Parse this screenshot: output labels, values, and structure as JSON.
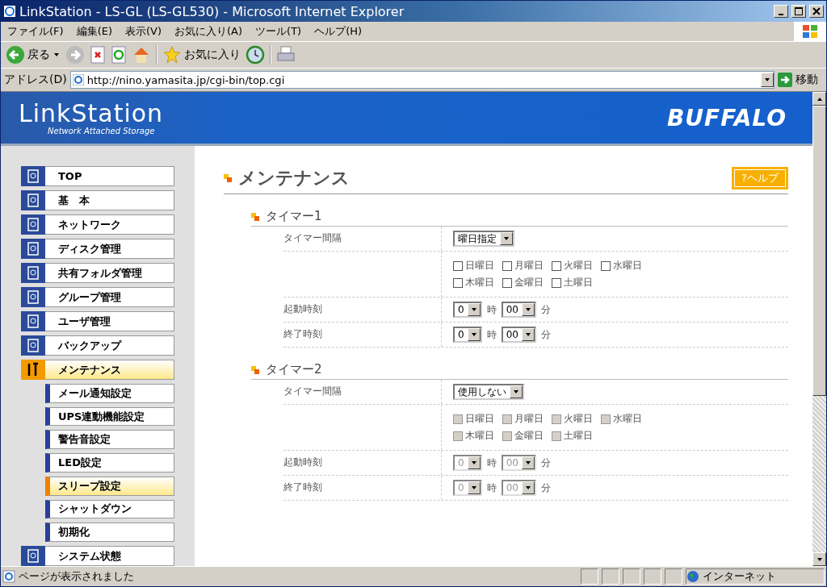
{
  "window": {
    "title": "LinkStation - LS-GL (LS-GL530) - Microsoft Internet Explorer"
  },
  "menu": [
    "ファイル(F)",
    "編集(E)",
    "表示(V)",
    "お気に入り(A)",
    "ツール(T)",
    "ヘルプ(H)"
  ],
  "toolbar": {
    "back": "戻る",
    "favorites": "お気に入り"
  },
  "address": {
    "label": "アドレス(D)",
    "url": "http://nino.yamasita.jp/cgi-bin/top.cgi",
    "go": "移動"
  },
  "banner": {
    "logo": "LinkStation",
    "tagline": "Network Attached Storage",
    "brand": "BUFFALO"
  },
  "sidebar": [
    {
      "label": "TOP",
      "selected": false
    },
    {
      "label": "基　本",
      "selected": false
    },
    {
      "label": "ネットワーク",
      "selected": false
    },
    {
      "label": "ディスク管理",
      "selected": false
    },
    {
      "label": "共有フォルダ管理",
      "selected": false
    },
    {
      "label": "グループ管理",
      "selected": false
    },
    {
      "label": "ユーザ管理",
      "selected": false
    },
    {
      "label": "バックアップ",
      "selected": false
    },
    {
      "label": "メンテナンス",
      "selected": true,
      "children": [
        {
          "label": "メール通知設定",
          "selected": false
        },
        {
          "label": "UPS連動機能設定",
          "selected": false
        },
        {
          "label": "警告音設定",
          "selected": false
        },
        {
          "label": "LED設定",
          "selected": false
        },
        {
          "label": "スリープ設定",
          "selected": true
        },
        {
          "label": "シャットダウン",
          "selected": false
        },
        {
          "label": "初期化",
          "selected": false
        }
      ]
    },
    {
      "label": "システム状態",
      "selected": false
    }
  ],
  "page": {
    "title": "メンテナンス",
    "help": "?ヘルプ"
  },
  "timers": [
    {
      "title": "タイマー1",
      "disabled": false,
      "interval": {
        "label": "タイマー間隔",
        "value": "曜日指定"
      },
      "days": [
        {
          "label": "日曜日",
          "checked": false
        },
        {
          "label": "月曜日",
          "checked": false
        },
        {
          "label": "火曜日",
          "checked": false
        },
        {
          "label": "水曜日",
          "checked": false
        },
        {
          "label": "木曜日",
          "checked": false
        },
        {
          "label": "金曜日",
          "checked": false
        },
        {
          "label": "土曜日",
          "checked": false
        }
      ],
      "times": [
        {
          "label": "起動時刻",
          "hour": "0",
          "hour_unit": "時",
          "minute": "00",
          "minute_unit": "分"
        },
        {
          "label": "終了時刻",
          "hour": "0",
          "hour_unit": "時",
          "minute": "00",
          "minute_unit": "分"
        }
      ]
    },
    {
      "title": "タイマー2",
      "disabled": true,
      "interval": {
        "label": "タイマー間隔",
        "value": "使用しない"
      },
      "days": [
        {
          "label": "日曜日",
          "checked": false
        },
        {
          "label": "月曜日",
          "checked": false
        },
        {
          "label": "火曜日",
          "checked": false
        },
        {
          "label": "水曜日",
          "checked": false
        },
        {
          "label": "木曜日",
          "checked": false
        },
        {
          "label": "金曜日",
          "checked": false
        },
        {
          "label": "土曜日",
          "checked": false
        }
      ],
      "times": [
        {
          "label": "起動時刻",
          "hour": "0",
          "hour_unit": "時",
          "minute": "00",
          "minute_unit": "分"
        },
        {
          "label": "終了時刻",
          "hour": "0",
          "hour_unit": "時",
          "minute": "00",
          "minute_unit": "分"
        }
      ]
    }
  ],
  "status_bar": {
    "message": "ページが表示されました",
    "zone": "インターネット"
  }
}
